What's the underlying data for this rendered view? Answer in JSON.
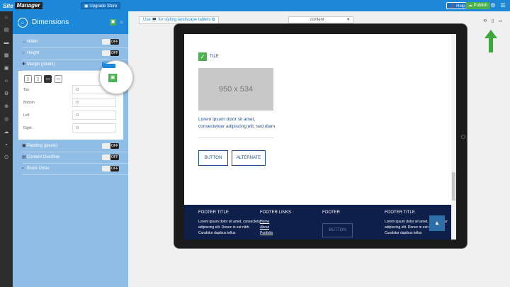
{
  "topbar": {
    "logo_part1": "Site",
    "logo_part2": "Manager",
    "upgrade_label": "Upgrade Store",
    "help_label": "Help",
    "publish_label": "Publish",
    "gear_icon": "gear-icon",
    "menu_icon": "hamburger-icon"
  },
  "rail": {
    "icons": [
      "home-icon",
      "page-icon",
      "folder-icon",
      "grid-icon",
      "image-icon",
      "code-icon",
      "settings-icon",
      "cart-icon",
      "globe-icon",
      "cloud-icon",
      "lock-icon",
      "power-icon"
    ]
  },
  "panel": {
    "title": "Dimensions",
    "rows": [
      {
        "label": "Width",
        "toggle": "OFF"
      },
      {
        "label": "Height",
        "toggle": "OFF"
      },
      {
        "label": "Margin (pixels)",
        "toggle": "ON"
      },
      {
        "label": "Padding (pixels)",
        "toggle": "OFF"
      },
      {
        "label": "Content Overflow",
        "toggle": "OFF"
      },
      {
        "label": "Block Order",
        "toggle": "OFF"
      }
    ],
    "margin": {
      "fields": [
        {
          "label": "Top",
          "value": "0"
        },
        {
          "label": "Bottom",
          "value": "0"
        },
        {
          "label": "Left",
          "value": "0"
        },
        {
          "label": "Right",
          "value": "0"
        }
      ]
    }
  },
  "workspace": {
    "note": "Use 💻 for styling landscape tablets ⧉",
    "select_value": "content",
    "caret": "▼"
  },
  "preview": {
    "tile_label": "TILE",
    "image_label": "950 x 534",
    "body_text": "Lorem ipsum dolor sit amet, consectetuer adipiscing elit, sed diam",
    "button_label": "BUTTON",
    "alternate_label": "ALTERNATE",
    "footer": {
      "col1_title": "FOOTER TITLE",
      "col1_text": "Lorem ipsum dolor sit amet, consectetur adipiscing elit. Donec in est nibh. Curabitur dapibus tellus",
      "col2_title": "FOOTER LINKS",
      "links": [
        "Home",
        "About",
        "Portfolio"
      ],
      "col3_title": "FOOTER",
      "footer_button": "BUTTON",
      "col4_title": "FOOTER TITLE",
      "col4_text": "Lorem ipsum dolor sit amet, consectetur adipiscing elit. Donec in est nibh. Curabitur dapibus tellus"
    }
  },
  "colors": {
    "accent": "#1e88d8",
    "panel": "#8fbde6",
    "green": "#4caf50",
    "footer_bg": "#0e1f4a"
  }
}
